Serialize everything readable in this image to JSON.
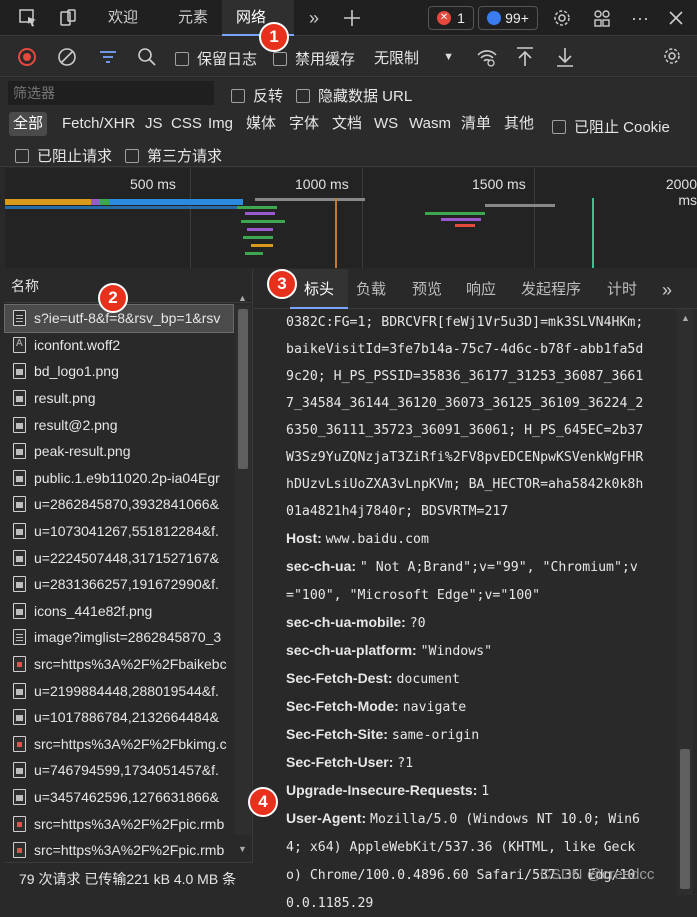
{
  "top_tabs": [
    {
      "label": "欢迎"
    },
    {
      "label": "元素"
    },
    {
      "label": "网络",
      "active": true
    }
  ],
  "badges": {
    "errors": "1",
    "messages": "99+"
  },
  "toolbar": {
    "preserve_log": "保留日志",
    "disable_cache": "禁用缓存",
    "throttle": "无限制"
  },
  "filter": {
    "placeholder": "筛选器",
    "invert": "反转",
    "hide_data_urls": "隐藏数据 URL"
  },
  "types": [
    "全部",
    "Fetch/XHR",
    "JS",
    "CSS",
    "Img",
    "媒体",
    "字体",
    "文档",
    "WS",
    "Wasm",
    "清单",
    "其他"
  ],
  "blocked_cookies": "已阻止 Cookie",
  "blocked_requests": "已阻止请求",
  "third_party": "第三方请求",
  "timeline_ticks": [
    "500 ms",
    "1000 ms",
    "1500 ms",
    "2000 ms"
  ],
  "left_panel": {
    "header": "名称",
    "requests": [
      {
        "name": "s?ie=utf-8&f=8&rsv_bp=1&rsv",
        "type": "doc",
        "selected": true
      },
      {
        "name": "iconfont.woff2",
        "type": "font"
      },
      {
        "name": "bd_logo1.png",
        "type": "img"
      },
      {
        "name": "result.png",
        "type": "img"
      },
      {
        "name": "result@2.png",
        "type": "img"
      },
      {
        "name": "peak-result.png",
        "type": "img"
      },
      {
        "name": "public.1.e9b11020.2p-ia04Egr",
        "type": "img"
      },
      {
        "name": "u=2862845870,3932841066&",
        "type": "img"
      },
      {
        "name": "u=1073041267,551812284&f.",
        "type": "img"
      },
      {
        "name": "u=2224507448,3171527167&",
        "type": "img"
      },
      {
        "name": "u=2831366257,191672990&f.",
        "type": "img"
      },
      {
        "name": "icons_441e82f.png",
        "type": "img"
      },
      {
        "name": "image?imglist=2862845870_3",
        "type": "doc"
      },
      {
        "name": "src=https%3A%2F%2Fbaikebc",
        "type": "redimg"
      },
      {
        "name": "u=2199884448,288019544&f.",
        "type": "img"
      },
      {
        "name": "u=1017886784,2132664484&",
        "type": "img"
      },
      {
        "name": "src=https%3A%2F%2Fbkimg.c",
        "type": "redimg"
      },
      {
        "name": "u=746794599,1734051457&f.",
        "type": "img"
      },
      {
        "name": "u=3457462596,1276631866&",
        "type": "img"
      },
      {
        "name": "src=https%3A%2F%2Fpic.rmb",
        "type": "redimg"
      },
      {
        "name": "src=https%3A%2F%2Fpic.rmb",
        "type": "redimg"
      }
    ],
    "status": "79 次请求  已传输221 kB  4.0 MB 条"
  },
  "right_panel": {
    "tabs": [
      "标头",
      "负载",
      "预览",
      "响应",
      "发起程序",
      "计时"
    ],
    "cookie_tail": "0382C:FG=1; BDRCVFR[feWj1Vr5u3D]=mk3SLVN4HKm;\nbaikeVisitId=3fe7b14a-75c7-4d6c-b78f-abb1fa5d\n9c20; H_PS_PSSID=35836_36177_31253_36087_3661\n7_34584_36144_36120_36073_36125_36109_36224_2\n6350_36111_35723_36091_36061; H_PS_645EC=2b37\nW3Sz9YuZQNzjaT3ZiRfi%2FV8pvEDCENpwKSVenkWgFHR\nhDUzvLsiUoZXA3vLnpKVm; BA_HECTOR=aha5842k0k8h\n01a4821h4j7840r; BDSVRTM=217",
    "headers": [
      {
        "name": "Host:",
        "value": "www.baidu.com"
      },
      {
        "name": "sec-ch-ua:",
        "value": "\" Not A;Brand\";v=\"99\", \"Chromium\";v\n=\"100\", \"Microsoft Edge\";v=\"100\""
      },
      {
        "name": "sec-ch-ua-mobile:",
        "value": "?0"
      },
      {
        "name": "sec-ch-ua-platform:",
        "value": "\"Windows\""
      },
      {
        "name": "Sec-Fetch-Dest:",
        "value": "document"
      },
      {
        "name": "Sec-Fetch-Mode:",
        "value": "navigate"
      },
      {
        "name": "Sec-Fetch-Site:",
        "value": "same-origin"
      },
      {
        "name": "Sec-Fetch-User:",
        "value": "?1"
      },
      {
        "name": "Upgrade-Insecure-Requests:",
        "value": "1"
      },
      {
        "name": "User-Agent:",
        "value": "Mozilla/5.0 (Windows NT 10.0; Win6\n4; x64) AppleWebKit/537.36 (KHTML, like Geck\no) Chrome/100.0.4896.60 Safari/537.36 Edg/10\n0.0.1185.29"
      }
    ]
  },
  "annotations": [
    "1",
    "2",
    "3",
    "4"
  ],
  "watermark": "CSDN @creedcc"
}
